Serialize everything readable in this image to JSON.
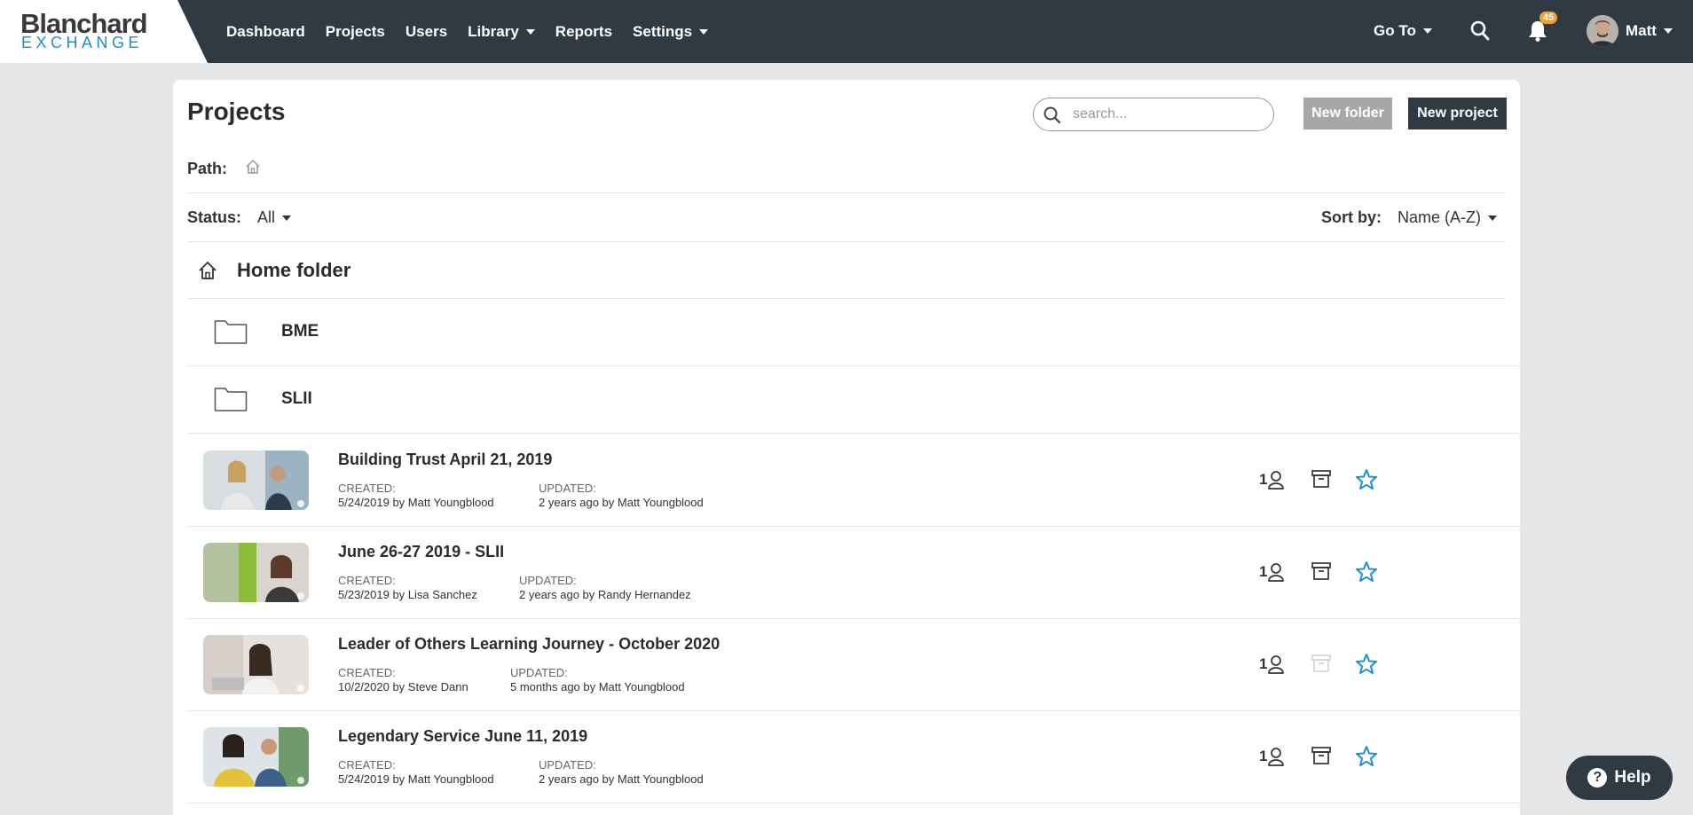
{
  "logo": {
    "line1": "Blanchard",
    "line2": "EXCHANGE"
  },
  "nav": {
    "items": [
      {
        "label": "Dashboard",
        "has_caret": false
      },
      {
        "label": "Projects",
        "has_caret": false
      },
      {
        "label": "Users",
        "has_caret": false
      },
      {
        "label": "Library",
        "has_caret": true
      },
      {
        "label": "Reports",
        "has_caret": false
      },
      {
        "label": "Settings",
        "has_caret": true
      }
    ],
    "goto_label": "Go To",
    "notification_count": "45",
    "user_name": "Matt"
  },
  "page": {
    "title": "Projects",
    "search_placeholder": "search...",
    "new_folder_label": "New folder",
    "new_project_label": "New project",
    "path_label": "Path:",
    "status_label": "Status:",
    "status_value": "All",
    "sort_label": "Sort by:",
    "sort_value": "Name (A-Z)",
    "home_folder_title": "Home folder"
  },
  "folders": [
    {
      "name": "BME"
    },
    {
      "name": "SLII"
    }
  ],
  "projects": [
    {
      "title": "Building Trust April 21, 2019",
      "created_label": "CREATED:",
      "created": "5/24/2019 by Matt Youngblood",
      "updated_label": "UPDATED:",
      "updated": "2 years ago by Matt Youngblood",
      "members": "1",
      "archive_enabled": true
    },
    {
      "title": "June 26-27 2019 - SLII",
      "created_label": "CREATED:",
      "created": "5/23/2019 by Lisa Sanchez",
      "updated_label": "UPDATED:",
      "updated": "2 years ago by Randy Hernandez",
      "members": "1",
      "archive_enabled": true
    },
    {
      "title": "Leader of Others Learning Journey - October 2020",
      "created_label": "CREATED:",
      "created": "10/2/2020 by Steve Dann",
      "updated_label": "UPDATED:",
      "updated": "5 months ago by Matt Youngblood",
      "members": "1",
      "archive_enabled": false
    },
    {
      "title": "Legendary Service June 11, 2019",
      "created_label": "CREATED:",
      "created": "5/24/2019 by Matt Youngblood",
      "updated_label": "UPDATED:",
      "updated": "2 years ago by Matt Youngblood",
      "members": "1",
      "archive_enabled": true
    }
  ],
  "help": {
    "label": "Help"
  },
  "colors": {
    "nav_bg": "#2f3a43",
    "accent_blue": "#1d8fd1",
    "badge": "#f0a030",
    "star": "#1d8fd1"
  }
}
